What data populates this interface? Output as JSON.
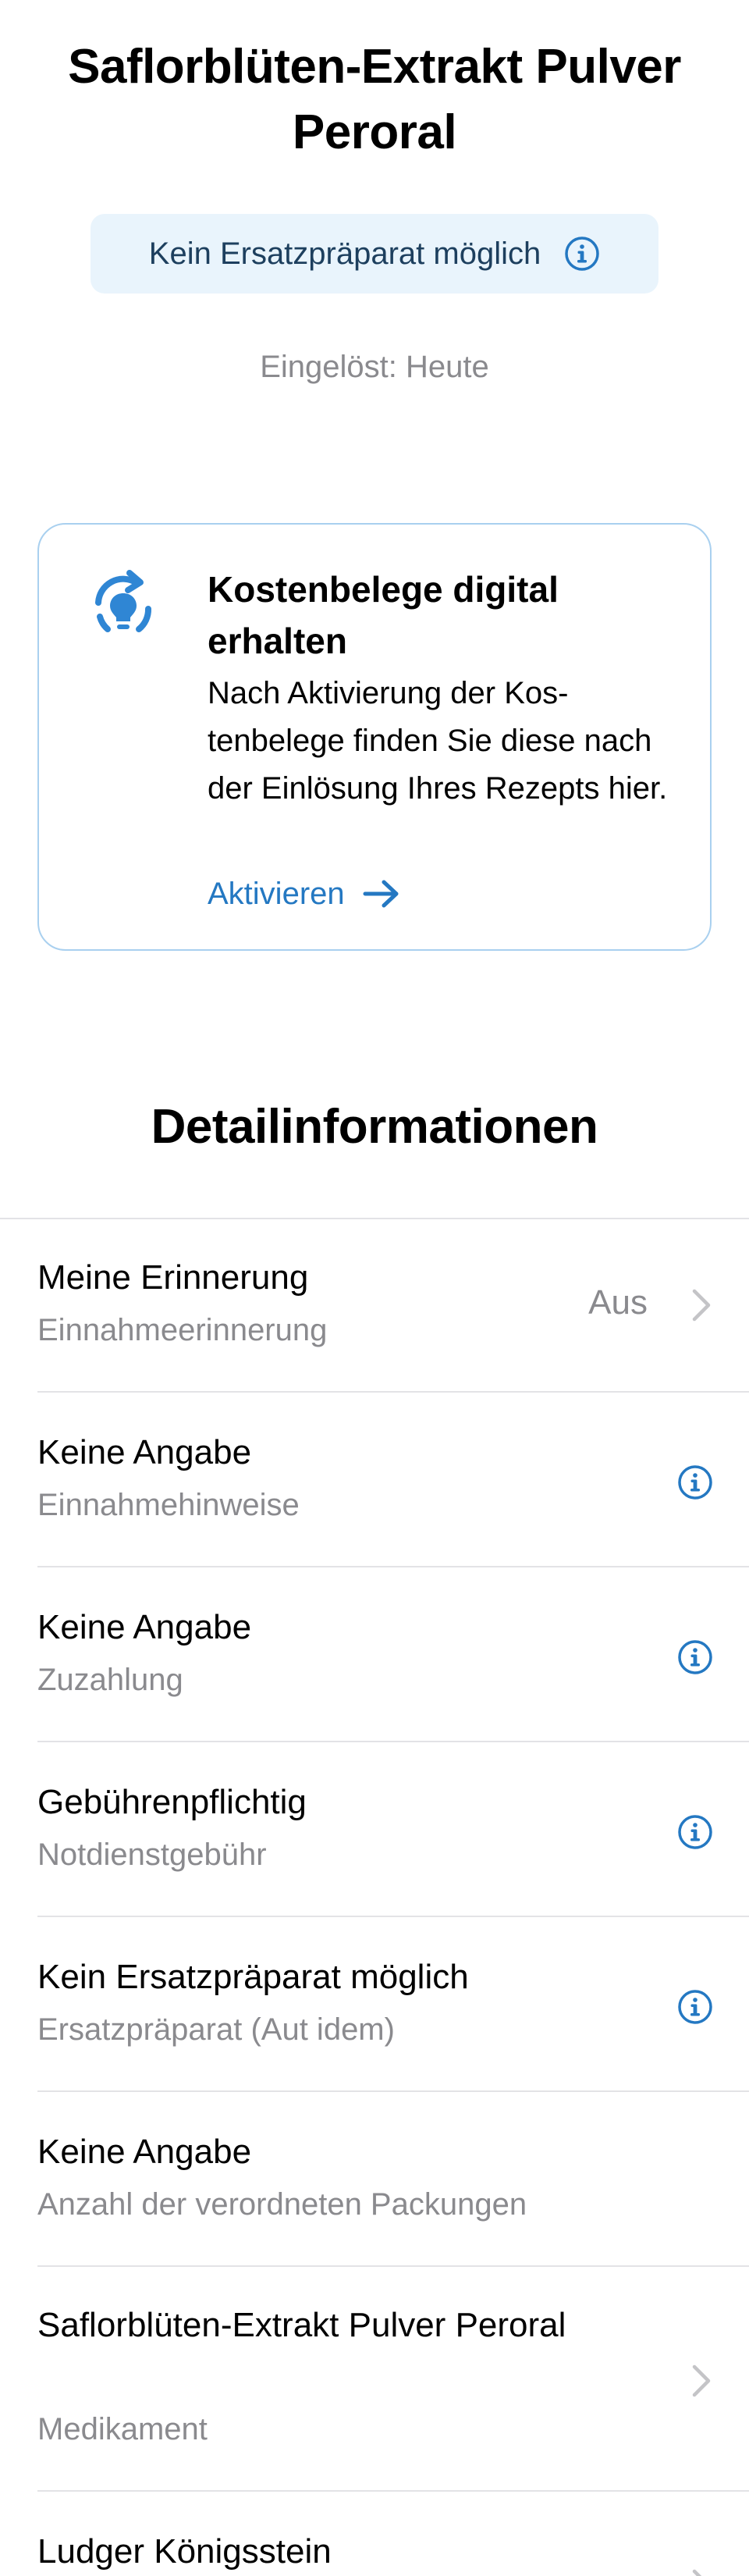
{
  "header": {
    "title": "Saflorblüten-Extrakt Pulver Peroral",
    "substitution_badge": "Kein Ersatzpräparat möglich",
    "redeemed_text": "Eingelöst: Heute"
  },
  "receipt_card": {
    "title": "Kostenbelege digital erhalten",
    "body": "Nach Aktivierung der Kos­tenbelege finden Sie diese nach der Einlösung Ihres Rezepts hier.",
    "action_label": "Aktivieren",
    "icon": "lightbulb-refresh-icon"
  },
  "details": {
    "section_title": "Detailinformationen",
    "rows": [
      {
        "value": "Meine Erinnerung",
        "label": "Einnahmeerinnerung",
        "trailing": "Aus",
        "accessory": "chevron-right-icon"
      },
      {
        "value": "Keine Angabe",
        "label": "Einnahmehinweise",
        "accessory": "info-icon"
      },
      {
        "value": "Keine Angabe",
        "label": "Zuzahlung",
        "accessory": "info-icon"
      },
      {
        "value": "Gebührenpflichtig",
        "label": "Notdienstgebühr",
        "accessory": "info-icon"
      },
      {
        "value": "Kein Ersatzpräparat möglich",
        "label": "Ersatzpräparat (Aut idem)",
        "accessory": "info-icon"
      },
      {
        "value": "Keine Angabe",
        "label": "Anzahl der verordneten Packungen",
        "accessory": ""
      },
      {
        "value": "Saflorblüten-Extrakt Pulver Peroral",
        "label": "Medikament",
        "accessory": "chevron-right-icon"
      },
      {
        "value": "Ludger Königsstein",
        "label": "",
        "accessory": "chevron-right-icon"
      }
    ]
  },
  "colors": {
    "accent": "#2478c2",
    "secondary_text": "#8a8a8e",
    "badge_background": "#e9f4fc",
    "card_border": "#a9d0ef",
    "divider": "#e3e3e6"
  }
}
